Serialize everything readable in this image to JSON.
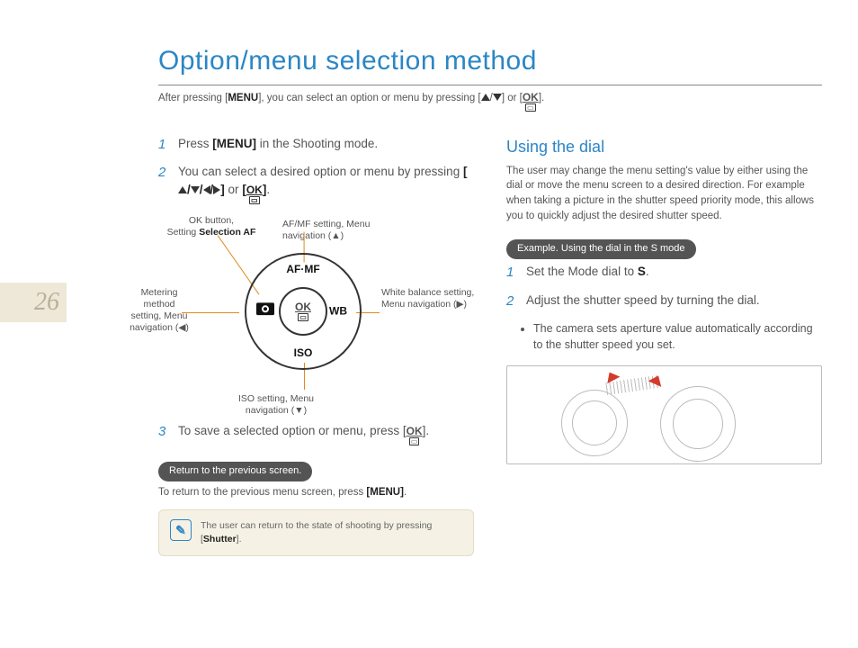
{
  "page_number": "26",
  "title": "Option/menu selection method",
  "intro_parts": {
    "a": "After pressing [",
    "menu": "MENU",
    "b": "], you can select an option or menu by pressing [",
    "c": "] or [",
    "d": "]."
  },
  "left": {
    "steps": {
      "s1": {
        "a": "Press ",
        "menu": "[MENU]",
        "b": " in the Shooting mode."
      },
      "s2": {
        "a": "You can select a desired option or menu by pressing ",
        "b": " or ",
        "c": "."
      },
      "s3": {
        "a": "To save a selected option or menu, press [",
        "b": "]."
      }
    },
    "callouts": {
      "ok": {
        "l1": "OK button,",
        "l2a": "Setting ",
        "l2b": "Selection AF"
      },
      "afmf": "AF/MF setting, Menu navigation (▲)",
      "meter": "Metering method setting, Menu navigation (◀)",
      "wb": "White balance setting, Menu navigation (▶)",
      "iso": "ISO setting, Menu navigation (▼)"
    },
    "dial": {
      "top": "AF·MF",
      "right": "WB",
      "bottom": "ISO",
      "left_icon": "metering-icon",
      "center": "OK"
    },
    "pill": "Return to the previous screen.",
    "return": {
      "a": "To return to the previous menu screen, press ",
      "menu": "[MENU]",
      "b": "."
    },
    "note": {
      "a": "The user can return to the state of shooting by pressing [",
      "shutter": "Shutter",
      "b": "]."
    }
  },
  "right": {
    "heading": "Using the dial",
    "para": "The user may change the menu setting's value by either using the dial or move the menu screen to a desired direction. For example when taking a picture in the shutter speed priority mode, this allows you to quickly adjust the desired shutter speed.",
    "pill": "Example. Using the dial in the S mode",
    "steps": {
      "s1": {
        "a": "Set the Mode dial to ",
        "s": "S",
        "b": "."
      },
      "s2": "Adjust the shutter speed by turning the dial."
    },
    "bullet": "The camera sets aperture value automatically according to the shutter speed you set."
  }
}
